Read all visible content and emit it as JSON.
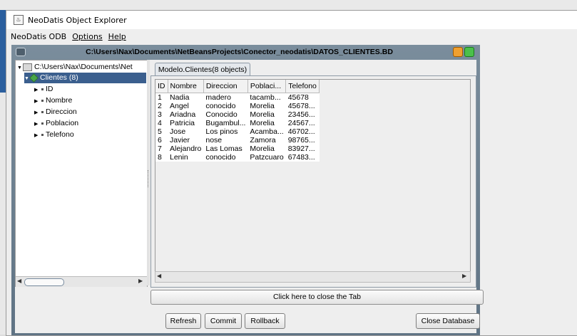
{
  "window": {
    "title": "NeoDatis Object Explorer",
    "app_icon": "neodatis-icon"
  },
  "menu": [
    "NeoDatis ODB",
    "Options",
    "Help"
  ],
  "frame": {
    "path": "C:\\Users\\Nax\\Documents\\NetBeansProjects\\Conector_neodatis\\DATOS_CLIENTES.BD",
    "menu_icon": "frame-menu-icon"
  },
  "tree": {
    "root": "C:\\Users\\Nax\\Documents\\Net",
    "class_node": "Clientes (8)",
    "fields": [
      "ID",
      "Nombre",
      "Direccion",
      "Poblacion",
      "Telefono"
    ]
  },
  "tab": {
    "label": "Modelo.Clientes(8 objects)",
    "close_label": "Click here to close the Tab"
  },
  "table": {
    "columns": [
      "ID",
      "Nombre",
      "Direccion",
      "Poblaci...",
      "Telefono"
    ],
    "rows": [
      [
        "1",
        "Nadia",
        "madero",
        "tacamb...",
        "45678"
      ],
      [
        "2",
        "Angel",
        "conocido",
        "Morelia",
        "45678..."
      ],
      [
        "3",
        "Ariadna",
        "Conocido",
        "Morelia",
        "23456..."
      ],
      [
        "4",
        "Patricia",
        "Bugambul...",
        "Morelia",
        "24567..."
      ],
      [
        "5",
        "Jose",
        "Los pinos",
        "Acamba...",
        "46702..."
      ],
      [
        "6",
        "Javier",
        "nose",
        "Zamora",
        "98765..."
      ],
      [
        "7",
        "Alejandro",
        "Las Lomas",
        "Morelia",
        "83927..."
      ],
      [
        "8",
        "Lenin",
        "conocido",
        "Patzcuaro",
        "67483..."
      ]
    ]
  },
  "buttons": {
    "refresh": "Refresh",
    "commit": "Commit",
    "rollback": "Rollback",
    "close_db": "Close Database"
  },
  "colors": {
    "selection": "#3b5f8e",
    "frame_title": "#6b7f8f",
    "desktop": "#2f78c5"
  }
}
